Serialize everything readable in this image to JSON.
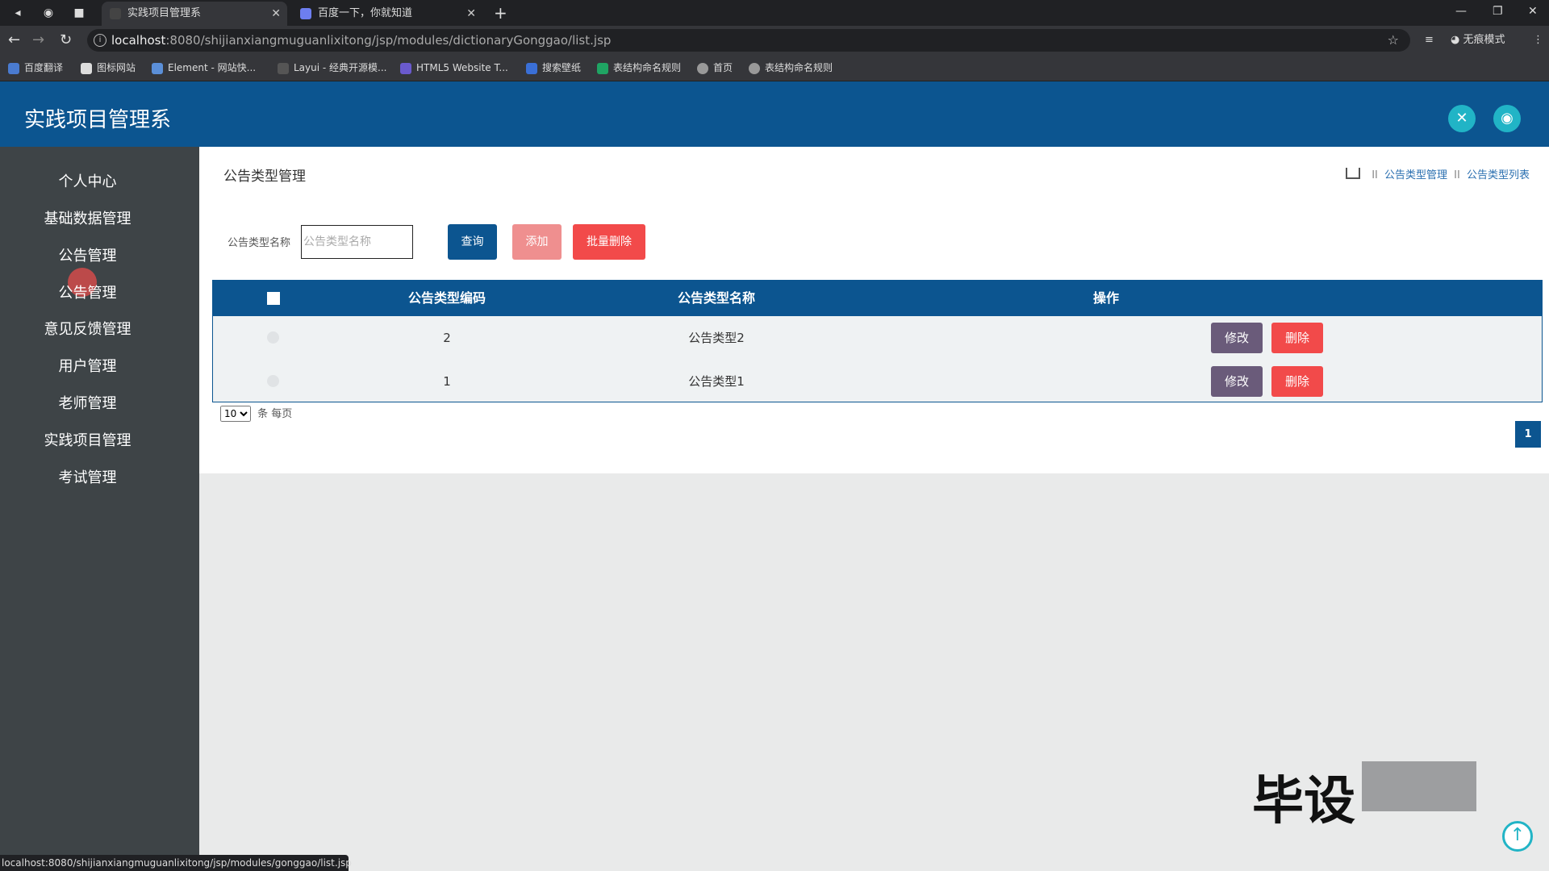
{
  "browser": {
    "tabs": [
      {
        "title": "实践项目管理系"
      },
      {
        "title": "百度一下，你就知道"
      }
    ],
    "url_host": "localhost",
    "url_rest": ":8080/shijianxiangmuguanlixitong/jsp/modules/dictionaryGonggao/list.jsp",
    "incognito_label": "无痕模式",
    "bookmarks": [
      {
        "label": "百度翻译"
      },
      {
        "label": "图标网站"
      },
      {
        "label": "Element - 网站快..."
      },
      {
        "label": "Layui - 经典开源模..."
      },
      {
        "label": "HTML5 Website T..."
      },
      {
        "label": "搜索壁纸"
      },
      {
        "label": "表结构命名规则"
      },
      {
        "label": "首页"
      },
      {
        "label": "表结构命名规则"
      }
    ],
    "status_url": "localhost:8080/shijianxiangmuguanlixitong/jsp/modules/gonggao/list.jsp"
  },
  "app": {
    "title": "实践项目管理系"
  },
  "sidebar": {
    "items": [
      {
        "label": "个人中心"
      },
      {
        "label": "基础数据管理"
      },
      {
        "label": "公告管理"
      },
      {
        "label": "公告管理"
      },
      {
        "label": "意见反馈管理"
      },
      {
        "label": "用户管理"
      },
      {
        "label": "老师管理"
      },
      {
        "label": "实践项目管理"
      },
      {
        "label": "考试管理"
      }
    ]
  },
  "main": {
    "page_title": "公告类型管理",
    "breadcrumb": [
      "公告类型管理",
      "公告类型列表"
    ],
    "breadcrumb_sep": "II",
    "search": {
      "label": "公告类型名称",
      "placeholder": "公告类型名称",
      "value": ""
    },
    "buttons": {
      "query": "查询",
      "add": "添加",
      "batch_delete": "批量删除"
    },
    "table": {
      "columns": [
        "公告类型编码",
        "公告类型名称",
        "操作"
      ],
      "rows": [
        {
          "code": "2",
          "name": "公告类型2"
        },
        {
          "code": "1",
          "name": "公告类型1"
        }
      ],
      "edit_label": "修改",
      "delete_label": "删除"
    },
    "pagination": {
      "page_size": "10",
      "page_size_suffix": "条 每页",
      "current_page": "1"
    }
  },
  "watermark": "毕设",
  "colors": {
    "header": "#0c5590",
    "sidebar": "#3e4447",
    "accent_teal": "#21b4c6",
    "danger": "#f24a4a",
    "edit": "#6a5b7a"
  }
}
